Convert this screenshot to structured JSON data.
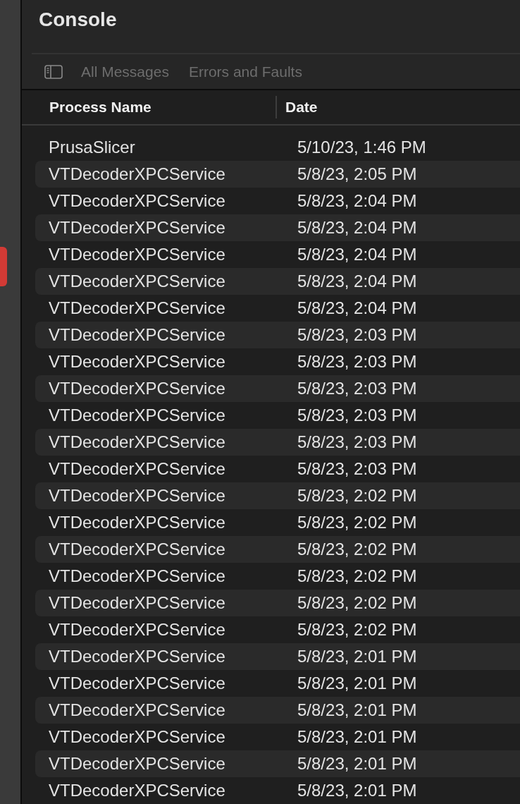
{
  "window": {
    "title": "Console"
  },
  "filters": [
    {
      "label": "All Messages",
      "selected": false
    },
    {
      "label": "Errors and Faults",
      "selected": false
    }
  ],
  "table": {
    "columns": [
      "Process Name",
      "Date"
    ],
    "rows": [
      {
        "process": "PrusaSlicer",
        "date": "5/10/23, 1:46 PM"
      },
      {
        "process": "VTDecoderXPCService",
        "date": "5/8/23, 2:05 PM"
      },
      {
        "process": "VTDecoderXPCService",
        "date": "5/8/23, 2:04 PM"
      },
      {
        "process": "VTDecoderXPCService",
        "date": "5/8/23, 2:04 PM"
      },
      {
        "process": "VTDecoderXPCService",
        "date": "5/8/23, 2:04 PM"
      },
      {
        "process": "VTDecoderXPCService",
        "date": "5/8/23, 2:04 PM"
      },
      {
        "process": "VTDecoderXPCService",
        "date": "5/8/23, 2:04 PM"
      },
      {
        "process": "VTDecoderXPCService",
        "date": "5/8/23, 2:03 PM"
      },
      {
        "process": "VTDecoderXPCService",
        "date": "5/8/23, 2:03 PM"
      },
      {
        "process": "VTDecoderXPCService",
        "date": "5/8/23, 2:03 PM"
      },
      {
        "process": "VTDecoderXPCService",
        "date": "5/8/23, 2:03 PM"
      },
      {
        "process": "VTDecoderXPCService",
        "date": "5/8/23, 2:03 PM"
      },
      {
        "process": "VTDecoderXPCService",
        "date": "5/8/23, 2:03 PM"
      },
      {
        "process": "VTDecoderXPCService",
        "date": "5/8/23, 2:02 PM"
      },
      {
        "process": "VTDecoderXPCService",
        "date": "5/8/23, 2:02 PM"
      },
      {
        "process": "VTDecoderXPCService",
        "date": "5/8/23, 2:02 PM"
      },
      {
        "process": "VTDecoderXPCService",
        "date": "5/8/23, 2:02 PM"
      },
      {
        "process": "VTDecoderXPCService",
        "date": "5/8/23, 2:02 PM"
      },
      {
        "process": "VTDecoderXPCService",
        "date": "5/8/23, 2:02 PM"
      },
      {
        "process": "VTDecoderXPCService",
        "date": "5/8/23, 2:01 PM"
      },
      {
        "process": "VTDecoderXPCService",
        "date": "5/8/23, 2:01 PM"
      },
      {
        "process": "VTDecoderXPCService",
        "date": "5/8/23, 2:01 PM"
      },
      {
        "process": "VTDecoderXPCService",
        "date": "5/8/23, 2:01 PM"
      },
      {
        "process": "VTDecoderXPCService",
        "date": "5/8/23, 2:01 PM"
      },
      {
        "process": "VTDecoderXPCService",
        "date": "5/8/23, 2:01 PM"
      }
    ]
  }
}
